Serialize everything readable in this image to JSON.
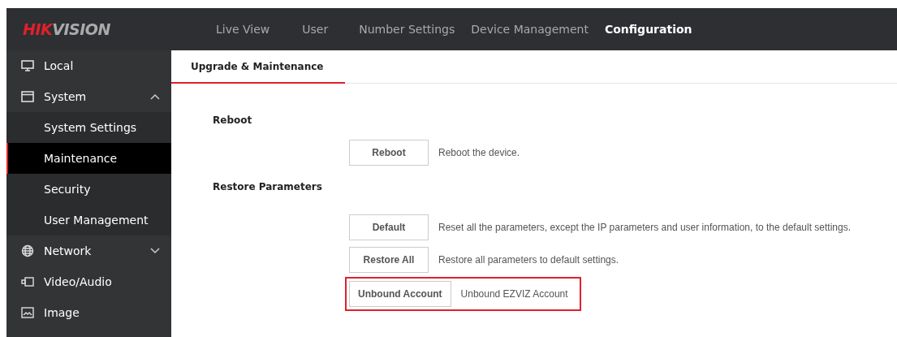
{
  "header": {
    "logo": {
      "brand_part": "HIK",
      "rest": "VISION"
    },
    "nav": [
      {
        "label": "Live View",
        "selected": false
      },
      {
        "label": "User",
        "selected": false
      },
      {
        "label": "Number Settings",
        "selected": false
      },
      {
        "label": "Device Management",
        "selected": false
      },
      {
        "label": "Configuration",
        "selected": true
      }
    ]
  },
  "sidebar": {
    "items": [
      {
        "label": "Local",
        "kind": "monitor",
        "selected": false
      },
      {
        "label": "System",
        "kind": "window",
        "expanded": true,
        "selected": false,
        "children": [
          {
            "label": "System Settings",
            "selected": false
          },
          {
            "label": "Maintenance",
            "selected": true
          },
          {
            "label": "Security",
            "selected": false
          },
          {
            "label": "User Management",
            "selected": false
          }
        ]
      },
      {
        "label": "Network",
        "kind": "globe",
        "expanded": false,
        "selected": false
      },
      {
        "label": "Video/Audio",
        "kind": "video",
        "selected": false
      },
      {
        "label": "Image",
        "kind": "image",
        "selected": false
      }
    ]
  },
  "tabs": [
    {
      "label": "Upgrade & Maintenance",
      "selected": true
    }
  ],
  "sections": [
    {
      "title": "Reboot",
      "actions": [
        {
          "button": "Reboot",
          "description": "Reboot the device.",
          "highlighted": false
        }
      ]
    },
    {
      "title": "Restore Parameters",
      "actions": [
        {
          "button": "Default",
          "description": "Reset all the parameters, except the IP parameters and user information, to the default settings.",
          "highlighted": false
        },
        {
          "button": "Restore All",
          "description": "Restore all parameters to default settings.",
          "highlighted": false
        },
        {
          "button": "Unbound Account",
          "description": "Unbound EZVIZ Account",
          "highlighted": true
        }
      ]
    }
  ]
}
